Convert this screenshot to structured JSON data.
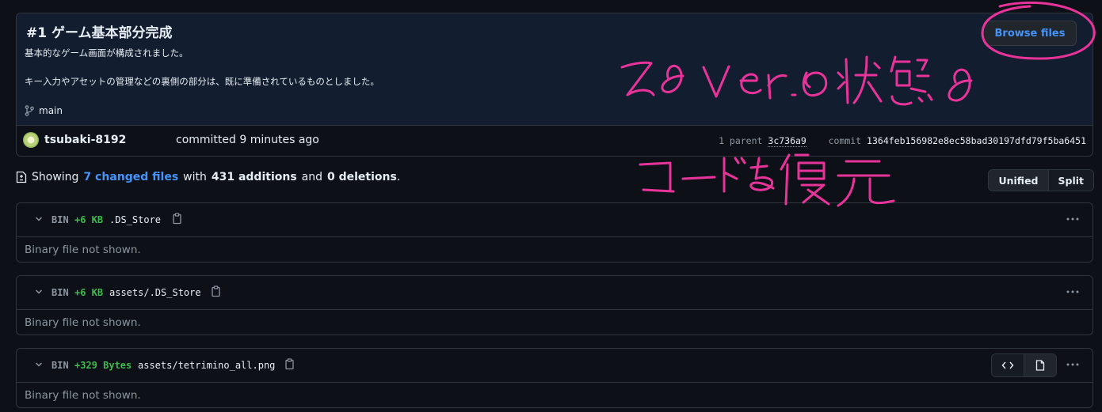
{
  "commit": {
    "title": "#1 ゲーム基本部分完成",
    "description_line1": "基本的なゲーム画面が構成されました。",
    "description_line2": "キー入力やアセットの管理などの裏側の部分は、既に準備されているものとしました。",
    "branch": "main",
    "browse_label": "Browse files",
    "author": "tsubaki-8192",
    "committed_text": "committed 9 minutes ago",
    "parent_label": "1 parent",
    "parent_hash": "3c736a9",
    "commit_label": "commit",
    "commit_hash": "1364feb156982e8ec58bad30197dfd79f5ba6451"
  },
  "summary": {
    "showing": "Showing",
    "changed_files": "7 changed files",
    "with": "with",
    "additions": "431 additions",
    "and": "and",
    "deletions": "0 deletions",
    "period": "."
  },
  "view_toggle": {
    "unified": "Unified",
    "split": "Split"
  },
  "files": [
    {
      "type": "BIN",
      "size": "+6 KB",
      "name": ".DS_Store",
      "body": "Binary file not shown."
    },
    {
      "type": "BIN",
      "size": "+6 KB",
      "name": "assets/.DS_Store",
      "body": "Binary file not shown."
    },
    {
      "type": "BIN",
      "size": "+329 Bytes",
      "name": "assets/tetrimino_all.png",
      "body": "Binary file not shown."
    }
  ],
  "annotation": {
    "line1": "その Ver. の状態の",
    "line2": "コードを復元",
    "color": "#e8339a"
  },
  "colors": {
    "background": "#0d1117",
    "accent": "#4493f8",
    "addition": "#3fb950",
    "muted": "#8d96a0"
  }
}
